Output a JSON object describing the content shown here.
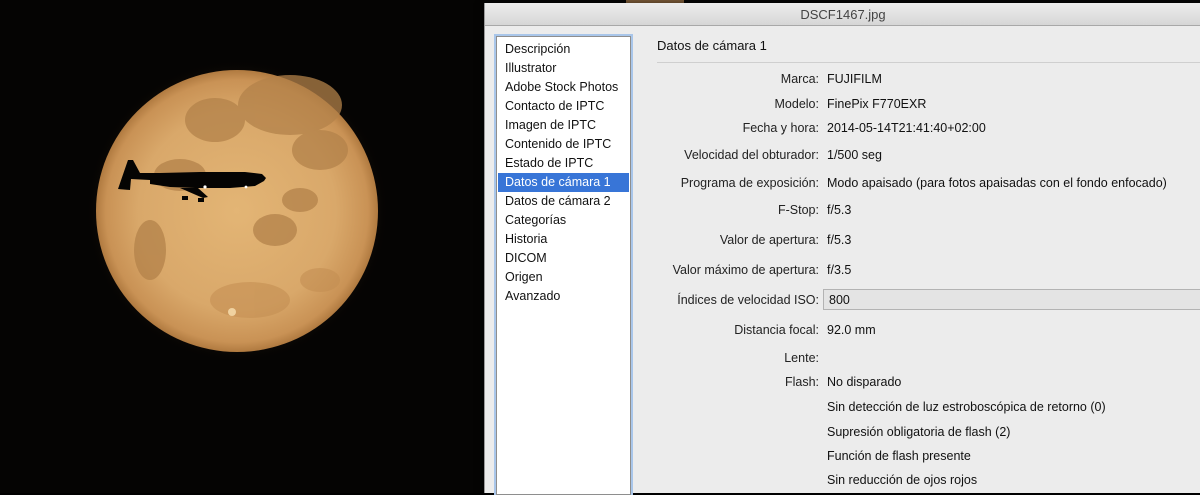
{
  "window": {
    "title": "DSCF1467.jpg"
  },
  "sidebar": {
    "items": [
      {
        "label": "Descripción"
      },
      {
        "label": "Illustrator"
      },
      {
        "label": "Adobe Stock Photos"
      },
      {
        "label": "Contacto de IPTC"
      },
      {
        "label": "Imagen de IPTC"
      },
      {
        "label": "Contenido de IPTC"
      },
      {
        "label": "Estado de IPTC"
      },
      {
        "label": "Datos de cámara 1",
        "selected": true
      },
      {
        "label": "Datos de cámara 2"
      },
      {
        "label": "Categorías"
      },
      {
        "label": "Historia"
      },
      {
        "label": "DICOM"
      },
      {
        "label": "Origen"
      },
      {
        "label": "Avanzado"
      }
    ]
  },
  "panel": {
    "title": "Datos de cámara 1",
    "fields": {
      "make": {
        "label": "Marca:",
        "value": "FUJIFILM"
      },
      "model": {
        "label": "Modelo:",
        "value": "FinePix F770EXR"
      },
      "datetime": {
        "label": "Fecha y hora:",
        "value": "2014-05-14T21:41:40+02:00"
      },
      "shutter": {
        "label": "Velocidad del obturador:",
        "value": "1/500 seg"
      },
      "program": {
        "label": "Programa de exposición:",
        "value": "Modo apaisado (para fotos apaisadas con el fondo enfocado)"
      },
      "fstop": {
        "label": "F-Stop:",
        "value": "f/5.3"
      },
      "aperture": {
        "label": "Valor de apertura:",
        "value": "f/5.3"
      },
      "max_aperture": {
        "label": "Valor máximo de apertura:",
        "value": "f/3.5"
      },
      "iso": {
        "label": "Índices de velocidad ISO:",
        "value": "800"
      },
      "focal": {
        "label": "Distancia focal:",
        "value": "92.0 mm"
      },
      "lens": {
        "label": "Lente:",
        "value": ""
      },
      "flash": {
        "label": "Flash:",
        "values": [
          "No disparado",
          "Sin detección de luz estroboscópica de retorno (0)",
          "Supresión obligatoria de flash (2)",
          "Función de flash presente",
          "Sin reducción de ojos rojos"
        ]
      }
    }
  },
  "colors": {
    "selection": "#3875d7",
    "moon": "#d9a86a",
    "dialog_bg": "#ececec"
  },
  "icons": {
    "photo": "moon-with-airplane-silhouette"
  }
}
